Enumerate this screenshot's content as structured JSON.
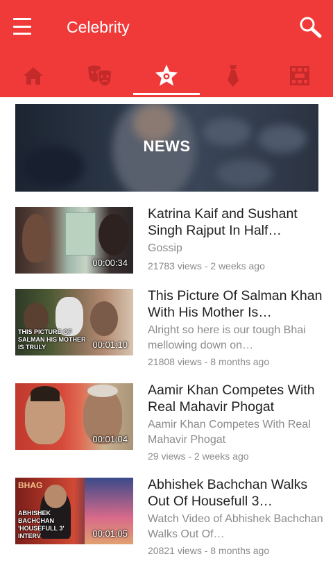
{
  "header": {
    "title": "Celebrity",
    "menu_icon": "hamburger-menu-icon",
    "search_icon": "search-icon"
  },
  "tabs": [
    {
      "icon": "home-icon",
      "selected": false
    },
    {
      "icon": "theater-masks-icon",
      "selected": false
    },
    {
      "icon": "star-badge-icon",
      "selected": true
    },
    {
      "icon": "tie-icon",
      "selected": false
    },
    {
      "icon": "film-reel-icon",
      "selected": false
    }
  ],
  "colors": {
    "app_bar": "#f03a3a",
    "tab_icon_inactive": "#c42a2a",
    "tab_icon_active": "#ffffff",
    "secondary_text": "#8a8a8a"
  },
  "banner": {
    "label": "NEWS"
  },
  "videos": [
    {
      "title": "Katrina Kaif and Sushant Singh Rajput In Half…",
      "description": "Gossip",
      "meta": "21783 views - 2 weeks ago",
      "duration": "00:00:34",
      "thumb_caption": ""
    },
    {
      "title": "This Picture Of Salman Khan With His Mother Is…",
      "description": "Alright so here is our tough Bhai mellowing down on…",
      "meta": "21808 views - 8 months ago",
      "duration": "00:01:10",
      "thumb_caption": "THIS PICTURE OF SALMAN HIS MOTHER IS TRULY"
    },
    {
      "title": "Aamir Khan Competes With Real Mahavir Phogat",
      "description": "Aamir Khan Competes With Real Mahavir Phogat",
      "meta": "29 views - 2 weeks ago",
      "duration": "00:01:04",
      "thumb_caption": ""
    },
    {
      "title": "Abhishek Bachchan Walks Out Of Housefull 3…",
      "description": "Watch Video of Abhishek Bachchan Walks Out Of…",
      "meta": "20821 views - 8 months ago",
      "duration": "00:01:05",
      "thumb_caption": "ABHISHEK BACHCHAN 'HOUSEFULL 3' INTERV"
    }
  ]
}
